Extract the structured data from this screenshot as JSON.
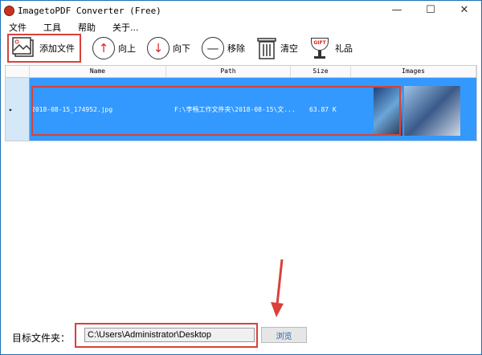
{
  "window": {
    "title": "ImagetoPDF Converter (Free)",
    "minimize": "—",
    "maximize": "☐",
    "close": "✕"
  },
  "menu": [
    "文件",
    "工具",
    "帮助",
    "关于..."
  ],
  "toolbar": {
    "add": "添加文件",
    "up": "向上",
    "down": "向下",
    "remove": "移除",
    "clear": "清空",
    "gift": "礼品",
    "gift_badge": "GIFT"
  },
  "table": {
    "columns": [
      "Name",
      "Path",
      "Size",
      "Images"
    ],
    "rows": [
      {
        "name": "2018-08-15_174952.jpg",
        "path": "F:\\李畅工作文件夹\\2018-08-15\\文...",
        "size": "63.87 K"
      }
    ]
  },
  "bottom": {
    "label": "目标文件夹：",
    "path": "C:\\Users\\Administrator\\Desktop",
    "browse": "浏览"
  },
  "colors": {
    "selection": "#3399ff",
    "highlight": "#d9413a"
  }
}
